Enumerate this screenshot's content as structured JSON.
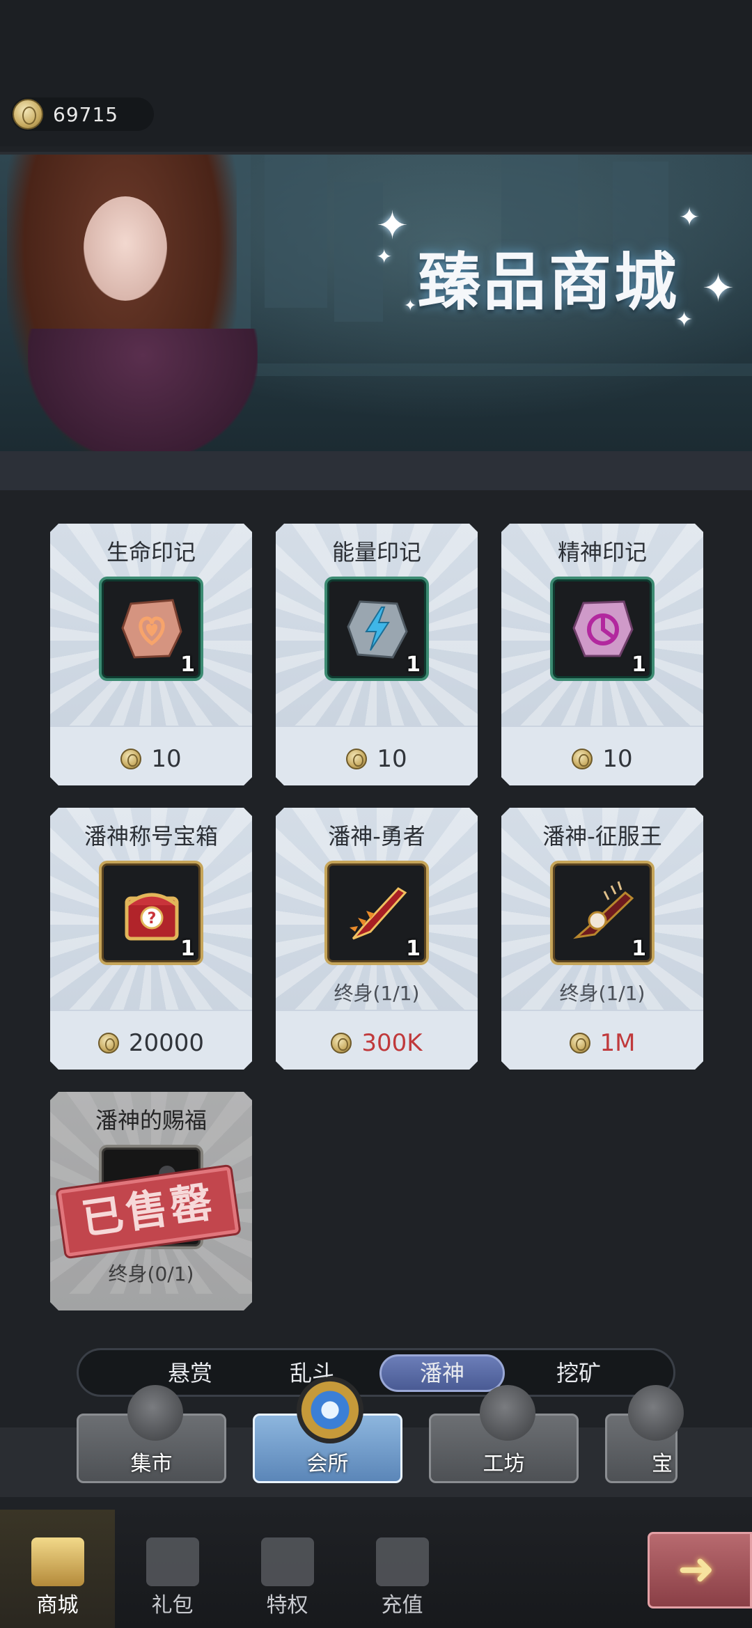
{
  "currency": {
    "amount": "69715",
    "icon": "coin-icon"
  },
  "banner": {
    "title": "臻品商城"
  },
  "items": [
    {
      "name": "生命印记",
      "count": "1",
      "price": "10",
      "limit": "",
      "icon": "heart-rune-icon",
      "price_color": "#30343a"
    },
    {
      "name": "能量印记",
      "count": "1",
      "price": "10",
      "limit": "",
      "icon": "lightning-rune-icon",
      "price_color": "#30343a"
    },
    {
      "name": "精神印记",
      "count": "1",
      "price": "10",
      "limit": "",
      "icon": "spirit-rune-icon",
      "price_color": "#30343a"
    },
    {
      "name": "潘神称号宝箱",
      "count": "1",
      "price": "20000",
      "limit": "",
      "icon": "treasure-chest-icon",
      "price_color": "#30343a"
    },
    {
      "name": "潘神-勇者",
      "count": "1",
      "price": "300K",
      "limit": "终身(1/1)",
      "icon": "red-blade-icon",
      "price_color": "#c0393b"
    },
    {
      "name": "潘神-征服王",
      "count": "1",
      "price": "1M",
      "limit": "终身(1/1)",
      "icon": "spiked-blade-icon",
      "price_color": "#c0393b"
    },
    {
      "name": "潘神的赐福",
      "count": "",
      "price": "",
      "limit": "终身(0/1)",
      "icon": "blessing-staff-icon",
      "sold_label": "已售罄"
    }
  ],
  "categories": [
    {
      "label": "悬赏",
      "active": false
    },
    {
      "label": "乱斗",
      "active": false
    },
    {
      "label": "潘神",
      "active": true
    },
    {
      "label": "挖矿",
      "active": false
    }
  ],
  "shops": [
    {
      "label": "集市",
      "icon": "money-bag-icon",
      "active": false
    },
    {
      "label": "会所",
      "icon": "crystal-emblem-icon",
      "active": true
    },
    {
      "label": "工坊",
      "icon": "gear-workshop-icon",
      "active": false
    },
    {
      "label": "宝",
      "icon": "treasure-icon",
      "active": false
    }
  ],
  "nav": [
    {
      "label": "商城",
      "icon": "shop-gate-icon",
      "active": true
    },
    {
      "label": "礼包",
      "icon": "gift-box-icon",
      "active": false
    },
    {
      "label": "特权",
      "icon": "crown-icon",
      "active": false
    },
    {
      "label": "充值",
      "icon": "diamond-icon",
      "active": false
    }
  ],
  "colors": {
    "accent_red": "#c0393b",
    "active_tab": "#5a6ba6",
    "card_bg": "#cfd8e3"
  }
}
